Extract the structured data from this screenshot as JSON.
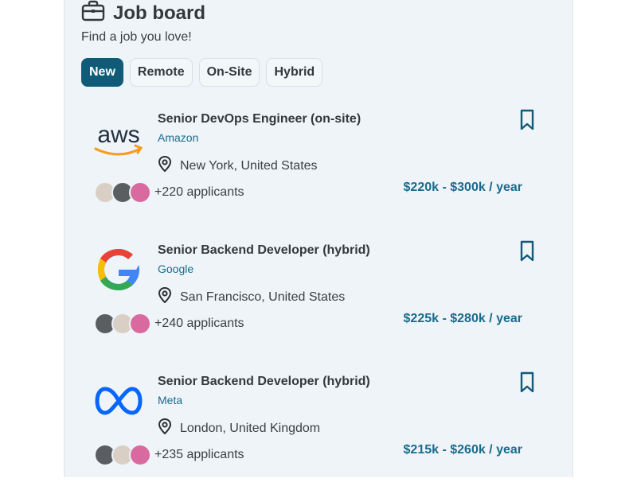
{
  "header": {
    "title": "Job board",
    "subtitle": "Find a job you love!",
    "icon": "briefcase-icon"
  },
  "filters": [
    "New",
    "Remote",
    "On-Site",
    "Hybrid"
  ],
  "active_filter": "New",
  "colors": {
    "accent": "#0f5b78",
    "link": "#1a6b8c",
    "panel_bg": "#eef4f8"
  },
  "jobs": [
    {
      "title": "Senior DevOps Engineer (on-site)",
      "company": "Amazon",
      "logo_text": "aws",
      "location": "New York, United States",
      "applicants": "+220 applicants",
      "salary": "$220k - $300k / year"
    },
    {
      "title": "Senior Backend Developer (hybrid)",
      "company": "Google",
      "logo_text": "G",
      "location": "San Francisco, United States",
      "applicants": "+240 applicants",
      "salary": "$225k - $280k / year"
    },
    {
      "title": "Senior Backend Developer (hybrid)",
      "company": "Meta",
      "logo_text": "∞",
      "location": "London, United Kingdom",
      "applicants": "+235 applicants",
      "salary": "$215k - $260k / year"
    }
  ]
}
